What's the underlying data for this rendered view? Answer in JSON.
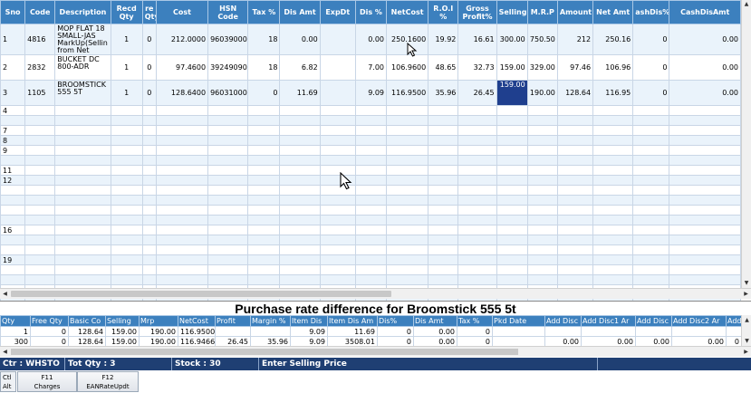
{
  "grid": {
    "columns": [
      "Sno",
      "Code",
      "Description",
      "Recd Qty",
      "Free Qty",
      "Cost",
      "HSN Code",
      "Tax %",
      "Dis Amt",
      "ExpDt",
      "Dis %",
      "NetCost",
      "R.O.I %",
      "Gross Profit%",
      "Selling",
      "M.R.P",
      "Amount",
      "Net Amt",
      "CashDis%",
      "CashDisAmt"
    ],
    "columns_display": [
      "Sno",
      "Code",
      "Description",
      "Recd Qty",
      "re Qty",
      "Cost",
      "HSN Code",
      "Tax %",
      "Dis Amt",
      "ExpDt",
      "Dis %",
      "NetCost",
      "R.O.I %",
      "Gross Profit%",
      "Selling",
      "M.R.P",
      "Amount",
      "Net Amt",
      "ashDis%",
      "CashDisAmt"
    ],
    "rows": [
      {
        "sno": "1",
        "code": "4816",
        "desc": "MOP FLAT 18 SMALL-JAS MarkUp(Sellin from Net",
        "recd": "1",
        "free": "0",
        "cost": "212.0000",
        "hsn": "96039000",
        "tax": "18",
        "disamt": "0.00",
        "expdt": "",
        "dispct": "0.00",
        "netcost": "250.1600",
        "roi": "19.92",
        "gp": "16.61",
        "selling": "300.00",
        "mrp": "750.50",
        "amount": "212",
        "netamt": "250.16",
        "cashdispct": "0",
        "cashdisamt": "0.00"
      },
      {
        "sno": "2",
        "code": "2832",
        "desc": "BUCKET DC 800-ADR",
        "recd": "1",
        "free": "0",
        "cost": "97.4600",
        "hsn": "39249090",
        "tax": "18",
        "disamt": "6.82",
        "expdt": "",
        "dispct": "7.00",
        "netcost": "106.9600",
        "roi": "48.65",
        "gp": "32.73",
        "selling": "159.00",
        "mrp": "329.00",
        "amount": "97.46",
        "netamt": "106.96",
        "cashdispct": "0",
        "cashdisamt": "0.00"
      },
      {
        "sno": "3",
        "code": "1105",
        "desc": "BROOMSTICK 555 5T",
        "recd": "1",
        "free": "0",
        "cost": "128.6400",
        "hsn": "96031000",
        "tax": "0",
        "disamt": "11.69",
        "expdt": "",
        "dispct": "9.09",
        "netcost": "116.9500",
        "roi": "35.96",
        "gp": "26.45",
        "selling": "159.00",
        "mrp": "190.00",
        "amount": "128.64",
        "netamt": "116.95",
        "cashdispct": "0",
        "cashdisamt": "0.00"
      }
    ],
    "row_numbers": [
      "4",
      "",
      "7",
      "8",
      "9",
      "",
      "11",
      "12",
      "",
      "",
      "",
      "",
      "16",
      "",
      "",
      "19",
      "",
      "",
      "",
      "",
      ""
    ]
  },
  "panel": {
    "title": "Purchase rate difference for Broomstick 555 5t"
  },
  "lower_grid": {
    "columns": [
      "Qty",
      "Free Qty",
      "Basic Co",
      "Selling",
      "Mrp",
      "NetCost",
      "Profit",
      "Margin %",
      "Item Dis",
      "Item Dis Am",
      "Dis%",
      "Dis Amt",
      "Tax %",
      "Pkd Date",
      "Add Disc",
      "Add Disc1 Ar",
      "Add Disc",
      "Add Disc2 Ar",
      "Add Disc"
    ],
    "rows": [
      [
        "1",
        "0",
        "128.64",
        "159.00",
        "190.00",
        "116.9500",
        "",
        "",
        "9.09",
        "11.69",
        "0",
        "0.00",
        "0",
        "",
        "",
        "",
        "",
        "",
        ""
      ],
      [
        "300",
        "0",
        "128.64",
        "159.00",
        "190.00",
        "116.9466",
        "26.45",
        "35.96",
        "9.09",
        "3508.01",
        "0",
        "0.00",
        "0",
        "",
        "0.00",
        "0.00",
        "0.00",
        "0.00",
        "0"
      ]
    ]
  },
  "status": {
    "ctr": "Ctr : WHSTO",
    "tot_qty": "Tot Qty : 3",
    "stock": "Stock : 30",
    "message": "Enter Selling Price"
  },
  "fkeys": {
    "alt_top": "Ctl",
    "alt_bottom": "Alt",
    "f11_key": "F11",
    "f11_label": "Charges",
    "f12_key": "F12",
    "f12_label": "EANRateUpdt"
  },
  "colors": {
    "header": "#3c80be",
    "status": "#1f3f73",
    "selected_cell": "#1f3f8e",
    "row_alt": "#eaf3fb"
  }
}
